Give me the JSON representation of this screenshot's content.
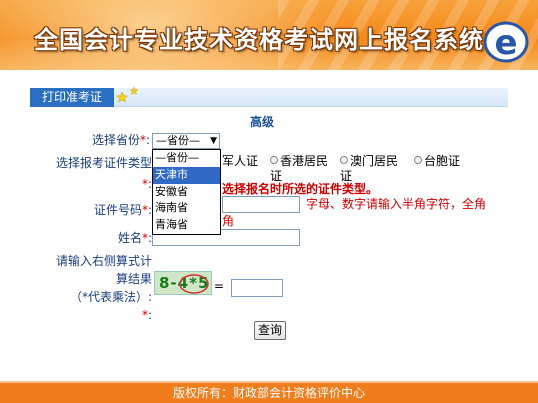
{
  "banner": {
    "title": "全国会计专业技术资格考试网上报名系统",
    "logo": "e"
  },
  "tab": {
    "label": "打印准考证"
  },
  "level": "高级",
  "province": {
    "label": "选择省份",
    "selected": "—省份—",
    "options": [
      "—省份—",
      "天津市",
      "安徽省",
      "海南省",
      "青海省"
    ],
    "highlighted": "天津市"
  },
  "cert_type": {
    "label_line1": "选择报考证件类型",
    "radios": [
      "军人证",
      "香港居民证",
      "澳门居民证",
      "台胞证"
    ],
    "warning": "选择报名时所选的证件类型。"
  },
  "id_number": {
    "label": "证件号码",
    "hint_line1": "字母、数字请输入半角字符，全角",
    "hint_line2_tail": "角"
  },
  "name": {
    "label": "姓名"
  },
  "captcha": {
    "label_line1": "请输入右侧算式计",
    "label_line2": "算结果",
    "label_line3": "（*代表乘法）:",
    "expression": "8-4*5",
    "equals": "="
  },
  "required_mark": "*",
  "colon": ":",
  "query_button": "查询",
  "footer": "版权所有：财政部会计资格评价中心",
  "colors": {
    "banner": "#f48a1a",
    "tab": "#2a6fc2",
    "footer": "#f07d1c",
    "warning": "#cc0000",
    "label": "#1a3f7a"
  }
}
